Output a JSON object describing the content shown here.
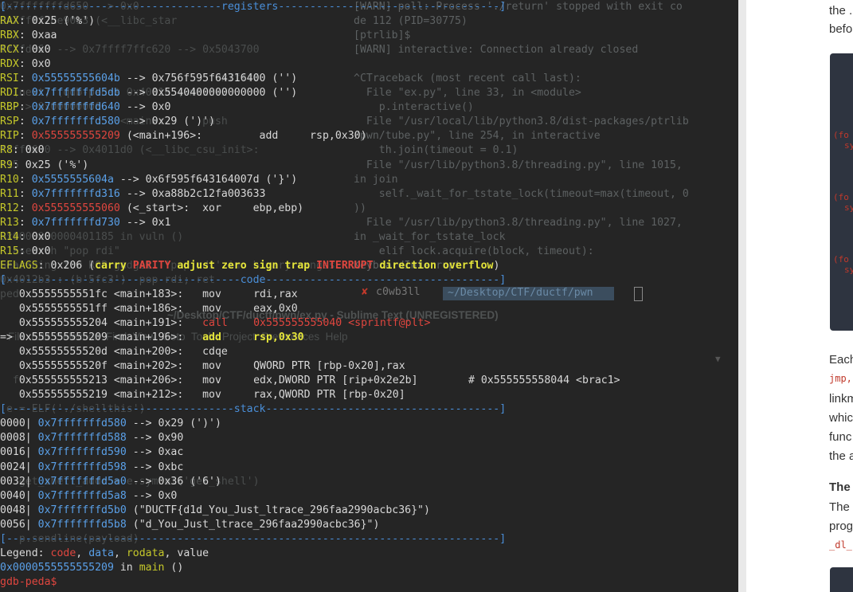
{
  "terminal": {
    "background_left": [
      "0x7fffffffd650 --> 0x0",
      "0x7ffff7de90b3 (<__libc_star",
      "  )",
      "ffffd660 --> 0x7ffff7ffc620 --> 0x5043700",
      "",
      "                                  0x7ffff",
      "  (next) (qdb-peda$ 0x4011e (<main+2",
      "  --> 0x00000000",
      "                   <main>:      push",
      "",
      "ffffd680 --> 0x4011d0 (<__libc_csu_init>:",
      "r15",
      "",
      "",
      "",
      "",
      "0x0000000000401185 in vuln ()",
      "  asearch \"pop rdi\"",
      "Searching for ROP gadget: 'pop rdi' in: binary ranges",
      "0x4012b3 : (b'5fc3')  pop rdi; ret",
      "ped",
      "",
      "  ",
      "",
      "",
      "",
      "  f",
      "",
      " e = ELF('./shellthis')",
      "",
      "",
      "",
      "",
      "   get_shell_addr = e.symbol('get_shell')",
      "",
      "",
      "",
      "   p.sendline(payload)",
      "",
      "",
      ""
    ],
    "background_right": [
      "[WARN] poll: Process './return' stopped with exit co",
      "de 112 (PID=30775)",
      "[ptrlib]$",
      "[WARN] interactive: Connection already closed",
      "",
      "^CTraceback (most recent call last):",
      "  File \"ex.py\", line 33, in <module>",
      "    p.interactive()",
      "  File \"/usr/local/lib/python3.8/dist-packages/ptrlib",
      "/pwn/tube.py\", line 254, in interactive",
      "    th.join(timeout = 0.1)",
      "  File \"/usr/lib/python3.8/threading.py\", line 1015,",
      "in join",
      "    self._wait_for_tstate_lock(timeout=max(timeout, 0",
      "))",
      "  File \"/usr/lib/python3.8/threading.py\", line 1027,",
      "in _wait_for_tstate_lock",
      "    elif lock.acquire(block, timeout):",
      "KeyboardInterrupt"
    ],
    "tab_user": "c0wb3ll",
    "tab_path": "~/Desktop/CTF/ductf/pwn",
    "window_title": "~/Desktop/CTF/ductf/pwn/ex.py - Sublime Text (UNREGISTERED)",
    "menu": "File  Edit  Selection  Find  View  Goto  Tools  Project  Preferences  Help"
  },
  "gdb": {
    "registers_header": "[----------------------------------registers-----------------------------------]",
    "registers": [
      {
        "name": "RAX",
        "value": "0x25 ('%')"
      },
      {
        "name": "RBX",
        "value": "0xaa"
      },
      {
        "name": "RCX",
        "value": "0x0"
      },
      {
        "name": "RDX",
        "value": "0x0"
      },
      {
        "name": "RSI",
        "addr": "0x55555555604b",
        "rest": " --> 0x756f595f64316400 ('')"
      },
      {
        "name": "RDI",
        "addr": "0x7fffffffd5db",
        "rest": " --> 0x5540400000000000 ('')"
      },
      {
        "name": "RBP",
        "addr": "0x7fffffffd640",
        "rest": " --> 0x0"
      },
      {
        "name": "RSP",
        "addr": "0x7fffffffd580",
        "rest": " --> 0x29 (')')"
      },
      {
        "name": "RIP",
        "addr_red": "0x555555555209",
        "rest": " (<main+196>:         add     rsp,0x30)"
      },
      {
        "name": "R8",
        "value": "0x0"
      },
      {
        "name": "R9",
        "value": "0x25 ('%')"
      },
      {
        "name": "R10",
        "addr": "0x5555555604a",
        "rest": " --> 0x6f595f643164007d ('}')"
      },
      {
        "name": "R11",
        "addr": "0x7fffffffd316",
        "rest": " --> 0xa88b2c12fa003633"
      },
      {
        "name": "R12",
        "addr_red": "0x555555555060",
        "rest": " (<_start>:  xor     ebp,ebp)"
      },
      {
        "name": "R13",
        "addr": "0x7fffffffd730",
        "rest": " --> 0x1"
      },
      {
        "name": "R14",
        "value": "0x0"
      },
      {
        "name": "R15",
        "value": "0x0"
      }
    ],
    "eflags_label": "EFLAGS",
    "eflags_value": "0x206 (",
    "flags": [
      "carry",
      "PARITY",
      "adjust",
      "zero",
      "sign",
      "trap",
      "INTERRUPT",
      "direction",
      "overflow"
    ],
    "flags_end": ")",
    "code_header": "[-------------------------------------code-------------------------------------]",
    "code": [
      {
        "marker": "   ",
        "addr": "0x5555555551fc <main+183>:",
        "mnem": "mov",
        "ops": "rdi,rax",
        "style": "normal"
      },
      {
        "marker": "   ",
        "addr": "0x5555555551ff <main+186>:",
        "mnem": "mov",
        "ops": "eax,0x0",
        "style": "normal"
      },
      {
        "marker": "   ",
        "addr": "0x555555555204 <main+191>:",
        "mnem": "call",
        "ops": "0x555555555040 <sprintf@plt>",
        "style": "call"
      },
      {
        "marker": "=> ",
        "addr": "0x555555555209 <main+196>:",
        "mnem": "add",
        "ops": "rsp,0x30",
        "style": "current"
      },
      {
        "marker": "   ",
        "addr": "0x55555555520d <main+200>:",
        "mnem": "cdqe",
        "ops": "",
        "style": "normal"
      },
      {
        "marker": "   ",
        "addr": "0x55555555520f <main+202>:",
        "mnem": "mov",
        "ops": "QWORD PTR [rbp-0x20],rax",
        "style": "normal"
      },
      {
        "marker": "   ",
        "addr": "0x555555555213 <main+206>:",
        "mnem": "mov",
        "ops": "edx,DWORD PTR [rip+0x2e2b]        # 0x555555558044 <brac1>",
        "style": "normal"
      },
      {
        "marker": "   ",
        "addr": "0x555555555219 <main+212>:",
        "mnem": "mov",
        "ops": "rax,QWORD PTR [rbp-0x20]",
        "style": "normal"
      }
    ],
    "stack_header": "[------------------------------------stack-------------------------------------]",
    "stack": [
      {
        "off": "0000|",
        "addr": "0x7fffffffd580",
        "rest": " --> 0x29 (')')"
      },
      {
        "off": "0008|",
        "addr": "0x7fffffffd588",
        "rest": " --> 0x90"
      },
      {
        "off": "0016|",
        "addr": "0x7fffffffd590",
        "rest": " --> 0xac"
      },
      {
        "off": "0024|",
        "addr": "0x7fffffffd598",
        "rest": " --> 0xbc"
      },
      {
        "off": "0032|",
        "addr": "0x7fffffffd5a0",
        "rest": " --> 0x36 ('6')"
      },
      {
        "off": "0040|",
        "addr": "0x7fffffffd5a8",
        "rest": " --> 0x0"
      },
      {
        "off": "0048|",
        "addr": "0x7fffffffd5b0",
        "rest": " (\"DUCTF{d1d_You_Just_ltrace_296faa2990acbc36}\")"
      },
      {
        "off": "0056|",
        "addr": "0x7fffffffd5b8",
        "rest": " (\"d_You_Just_ltrace_296faa2990acbc36}\")"
      }
    ],
    "end_header": "[------------------------------------------------------------------------------]",
    "legend_label": "Legend: ",
    "legend_code": "code",
    "legend_data": "data",
    "legend_rodata": "rodata",
    "legend_value": "value",
    "location_addr": "0x0000555555555209",
    "location_in": " in ",
    "location_func": "main",
    "location_end": " ()",
    "prompt": "gdb-peda$"
  },
  "right_panel": {
    "top_lines": [
      "the .",
      "befo"
    ],
    "code_snippets": [
      "(fo",
      "sy",
      "(fo",
      "sy",
      "(fo",
      "sy"
    ],
    "para_lines": [
      "Each",
      "jmp,",
      "linkm",
      "whic",
      "func",
      "the a"
    ],
    "heading": "The",
    "para2": [
      "The",
      "prog",
      "_dl_"
    ]
  }
}
